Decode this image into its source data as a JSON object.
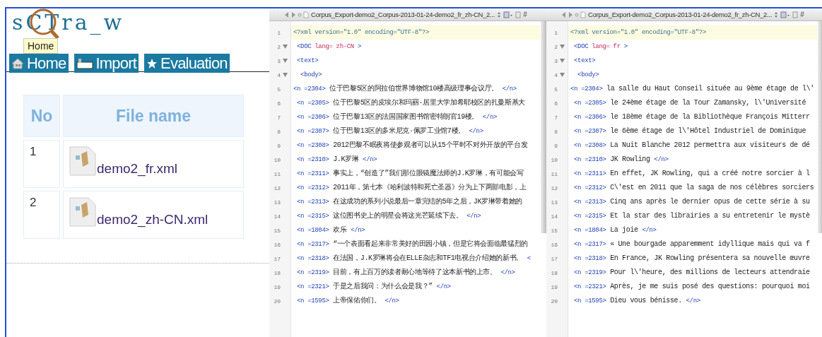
{
  "app": {
    "logo": "sCTra_w",
    "tooltip": "Home",
    "nav": [
      {
        "label": "Home"
      },
      {
        "label": "Import"
      },
      {
        "label": "Evaluation"
      }
    ],
    "table": {
      "columns": [
        "No",
        "File name"
      ],
      "rows": [
        {
          "no": "1",
          "file": "demo2_fr.xml"
        },
        {
          "no": "2",
          "file": "demo2_zh-CN.xml"
        }
      ]
    }
  },
  "editors": [
    {
      "title": "Corpus_Export-demo2_Corpus-2013-01-24-demo2_fr_zh-CN_2...",
      "symbol": "#",
      "lines": [
        {
          "number": "1",
          "fold": false,
          "current": true,
          "parts": [
            {
              "kind": "decl",
              "text": "<?xml version=\"1.0\" encoding=\"UTF-8\"?>"
            }
          ]
        },
        {
          "number": "2",
          "fold": true,
          "current": false,
          "parts": [
            {
              "kind": "tag",
              "text": " <DOC"
            },
            {
              "kind": "attr",
              "text": " lang= zh-CN"
            },
            {
              "kind": "tag",
              "text": " >"
            }
          ]
        },
        {
          "number": "3",
          "fold": true,
          "current": false,
          "parts": [
            {
              "kind": "tag",
              "text": " <text>"
            }
          ]
        },
        {
          "number": "4",
          "fold": true,
          "current": false,
          "parts": [
            {
              "kind": "tag",
              "text": "  <body>"
            }
          ]
        },
        {
          "number": "5",
          "fold": false,
          "current": false,
          "parts": [
            {
              "kind": "tag",
              "text": "<n =2304>"
            },
            {
              "kind": "text",
              "text": " 位于巴黎5区的阿拉伯世界博物馆10楼高级理事会议厅。 "
            },
            {
              "kind": "tag",
              "text": "</n>"
            }
          ]
        },
        {
          "number": "6",
          "fold": false,
          "current": false,
          "parts": [
            {
              "kind": "tag",
              "text": " <n =2305>"
            },
            {
              "kind": "text",
              "text": " 位于巴黎5区的皮埃尔和玛丽·居里大学加希耶校区的扎曼斯基大"
            }
          ]
        },
        {
          "number": "7",
          "fold": false,
          "current": false,
          "parts": [
            {
              "kind": "tag",
              "text": " <n =2306>"
            },
            {
              "kind": "text",
              "text": " 位于巴黎13区的法国国家图书馆密特朗官19楼。 "
            },
            {
              "kind": "tag",
              "text": "</n>"
            }
          ]
        },
        {
          "number": "8",
          "fold": false,
          "current": false,
          "parts": [
            {
              "kind": "tag",
              "text": " <n =2307>"
            },
            {
              "kind": "text",
              "text": " 位于巴黎13区的多米尼克·佩罗工业馆7楼。 "
            },
            {
              "kind": "tag",
              "text": "</n>"
            }
          ]
        },
        {
          "number": "9",
          "fold": false,
          "current": false,
          "parts": [
            {
              "kind": "tag",
              "text": " <n =2308>"
            },
            {
              "kind": "text",
              "text": " 2012巴黎不眠夜将使参观者可以从15个平时不对外开放的平台发"
            }
          ]
        },
        {
          "number": "10",
          "fold": false,
          "current": false,
          "parts": [
            {
              "kind": "tag",
              "text": " <n =2310>"
            },
            {
              "kind": "text",
              "text": " J.K罗琳 "
            },
            {
              "kind": "tag",
              "text": "</n>"
            }
          ]
        },
        {
          "number": "11",
          "fold": false,
          "current": false,
          "parts": [
            {
              "kind": "tag",
              "text": " <n =2311>"
            },
            {
              "kind": "text",
              "text": " 事实上，“创造了”我们那位眼镜魔法师的J.K罗琳，有可能会写"
            }
          ]
        },
        {
          "number": "12",
          "fold": false,
          "current": false,
          "parts": [
            {
              "kind": "tag",
              "text": " <n =2312>"
            },
            {
              "kind": "text",
              "text": " 2011年，第七本《哈利波特和死亡圣器》分为上下两部电影，上"
            }
          ]
        },
        {
          "number": "13",
          "fold": false,
          "current": false,
          "parts": [
            {
              "kind": "tag",
              "text": " <n =2313>"
            },
            {
              "kind": "text",
              "text": " 在这成功的系列小说最后一章完结的5年之后，JK罗琳带着她的"
            }
          ]
        },
        {
          "number": "14",
          "fold": false,
          "current": false,
          "parts": [
            {
              "kind": "tag",
              "text": " <n =2315>"
            },
            {
              "kind": "text",
              "text": " 这位图书史上的明星会将这光芒延续下去。 "
            },
            {
              "kind": "tag",
              "text": "</n>"
            }
          ]
        },
        {
          "number": "15",
          "fold": false,
          "current": false,
          "parts": [
            {
              "kind": "tag",
              "text": " <n =1804>"
            },
            {
              "kind": "text",
              "text": " 欢乐 "
            },
            {
              "kind": "tag",
              "text": "</n>"
            }
          ]
        },
        {
          "number": "16",
          "fold": false,
          "current": false,
          "parts": [
            {
              "kind": "tag",
              "text": " <n =2317>"
            },
            {
              "kind": "text",
              "text": " “一个表面看起来非常美好的田园小镇，但是它将会面临最猛烈的"
            }
          ]
        },
        {
          "number": "17",
          "fold": false,
          "current": false,
          "parts": [
            {
              "kind": "tag",
              "text": " <n =2318>"
            },
            {
              "kind": "text",
              "text": " 在法国，J.K罗琳将会在ELLE杂志和TF1电视台介绍她的新书。 "
            },
            {
              "kind": "tag",
              "text": "<"
            }
          ]
        },
        {
          "number": "18",
          "fold": false,
          "current": false,
          "parts": [
            {
              "kind": "tag",
              "text": " <n =2319>"
            },
            {
              "kind": "text",
              "text": " 目前，有上百万的读者耐心地等待了这本新书的上市。 "
            },
            {
              "kind": "tag",
              "text": "</n>"
            }
          ]
        },
        {
          "number": "19",
          "fold": false,
          "current": false,
          "parts": [
            {
              "kind": "tag",
              "text": " <n =2321>"
            },
            {
              "kind": "text",
              "text": " 于是之后我问：为什么会是我？” "
            },
            {
              "kind": "tag",
              "text": "</n>"
            }
          ]
        },
        {
          "number": "20",
          "fold": false,
          "current": false,
          "parts": [
            {
              "kind": "tag",
              "text": " <n =1595>"
            },
            {
              "kind": "text",
              "text": " 上帝保佑你们。 "
            },
            {
              "kind": "tag",
              "text": "</n>"
            }
          ]
        }
      ]
    },
    {
      "title": "Corpus_Export-demo2_Corpus-2013-01-24-demo2_fr_zh-CN_2...",
      "symbol": "#",
      "lines": [
        {
          "number": "1",
          "fold": false,
          "current": true,
          "parts": [
            {
              "kind": "decl",
              "text": "<?xml version=\"1.0\" encoding=\"UTF-8\"?>"
            }
          ]
        },
        {
          "number": "2",
          "fold": true,
          "current": false,
          "parts": [
            {
              "kind": "tag",
              "text": " <DOC"
            },
            {
              "kind": "attr",
              "text": " lang= fr"
            },
            {
              "kind": "tag",
              "text": " >"
            }
          ]
        },
        {
          "number": "3",
          "fold": true,
          "current": false,
          "parts": [
            {
              "kind": "tag",
              "text": " <text>"
            }
          ]
        },
        {
          "number": "4",
          "fold": true,
          "current": false,
          "parts": [
            {
              "kind": "tag",
              "text": "  <body>"
            }
          ]
        },
        {
          "number": "5",
          "fold": false,
          "current": false,
          "parts": [
            {
              "kind": "tag",
              "text": "<n =2304>"
            },
            {
              "kind": "text",
              "text": " la salle du Haut Conseil située au 9ème étage de l\\'"
            }
          ]
        },
        {
          "number": "6",
          "fold": false,
          "current": false,
          "parts": [
            {
              "kind": "tag",
              "text": " <n =2305>"
            },
            {
              "kind": "text",
              "text": " le 24ème étage de la Tour Zamansky, l\\'Université"
            }
          ]
        },
        {
          "number": "7",
          "fold": false,
          "current": false,
          "parts": [
            {
              "kind": "tag",
              "text": " <n =2306>"
            },
            {
              "kind": "text",
              "text": " le 18ème étage de la Bibliothèque François Mitterr"
            }
          ]
        },
        {
          "number": "8",
          "fold": false,
          "current": false,
          "parts": [
            {
              "kind": "tag",
              "text": " <n =2307>"
            },
            {
              "kind": "text",
              "text": " le 6ème étage de l\\'Hôtel Industriel de Dominique"
            }
          ]
        },
        {
          "number": "9",
          "fold": false,
          "current": false,
          "parts": [
            {
              "kind": "tag",
              "text": " <n =2308>"
            },
            {
              "kind": "text",
              "text": " La Nuit Blanche 2012 permettra aux visiteurs de dé"
            }
          ]
        },
        {
          "number": "10",
          "fold": false,
          "current": false,
          "parts": [
            {
              "kind": "tag",
              "text": " <n =2310>"
            },
            {
              "kind": "text",
              "text": " JK Rowling "
            },
            {
              "kind": "tag",
              "text": "</n>"
            }
          ]
        },
        {
          "number": "11",
          "fold": false,
          "current": false,
          "parts": [
            {
              "kind": "tag",
              "text": " <n =2311>"
            },
            {
              "kind": "text",
              "text": " En effet, JK Rowling, qui a créé notre sorcier à l"
            }
          ]
        },
        {
          "number": "12",
          "fold": false,
          "current": false,
          "parts": [
            {
              "kind": "tag",
              "text": " <n =2312>"
            },
            {
              "kind": "text",
              "text": " C\\'est en 2011 que la saga de nos célèbres sorciers"
            }
          ]
        },
        {
          "number": "13",
          "fold": false,
          "current": false,
          "parts": [
            {
              "kind": "tag",
              "text": " <n =2313>"
            },
            {
              "kind": "text",
              "text": " Cinq ans après le dernier opus de cette série à su"
            }
          ]
        },
        {
          "number": "14",
          "fold": false,
          "current": false,
          "parts": [
            {
              "kind": "tag",
              "text": " <n =2315>"
            },
            {
              "kind": "text",
              "text": " Et la star des librairies a su entretenir le mystè"
            }
          ]
        },
        {
          "number": "15",
          "fold": false,
          "current": false,
          "parts": [
            {
              "kind": "tag",
              "text": " <n =1804>"
            },
            {
              "kind": "text",
              "text": " La joie "
            },
            {
              "kind": "tag",
              "text": "</n>"
            }
          ]
        },
        {
          "number": "16",
          "fold": false,
          "current": false,
          "parts": [
            {
              "kind": "tag",
              "text": " <n =2317>"
            },
            {
              "kind": "text",
              "text": " « Une bourgade apparemment idyllique mais qui va f"
            }
          ]
        },
        {
          "number": "17",
          "fold": false,
          "current": false,
          "parts": [
            {
              "kind": "tag",
              "text": " <n =2318>"
            },
            {
              "kind": "text",
              "text": " En France, JK Rowling présentera sa nouvelle œuvre"
            }
          ]
        },
        {
          "number": "18",
          "fold": false,
          "current": false,
          "parts": [
            {
              "kind": "tag",
              "text": " <n =2319>"
            },
            {
              "kind": "text",
              "text": " Pour l\\'heure, des millions de lecteurs attendraie"
            }
          ]
        },
        {
          "number": "19",
          "fold": false,
          "current": false,
          "parts": [
            {
              "kind": "tag",
              "text": " <n =2321>"
            },
            {
              "kind": "text",
              "text": " Après, je me suis posé des questions: pourquoi moi"
            }
          ]
        },
        {
          "number": "20",
          "fold": false,
          "current": false,
          "parts": [
            {
              "kind": "tag",
              "text": " <n =1595>"
            },
            {
              "kind": "text",
              "text": " Dieu vous bénisse. "
            },
            {
              "kind": "tag",
              "text": "</n>"
            }
          ]
        }
      ]
    }
  ]
}
